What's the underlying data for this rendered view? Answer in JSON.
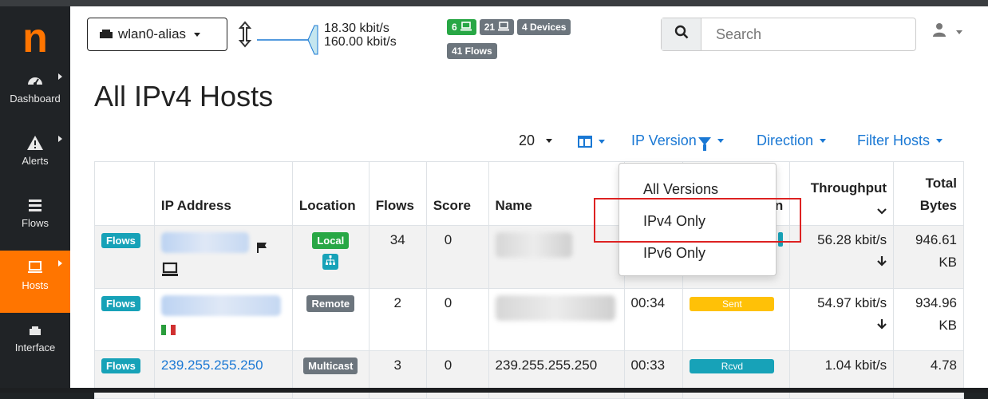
{
  "app": {
    "logo_letter": "n",
    "interface": "wlan0-alias",
    "throughput": {
      "upload": "18.30 kbit/s",
      "download": "160.00 kbit/s"
    },
    "badges": {
      "hosts_local": "6",
      "hosts_remote": "21",
      "devices": "4 Devices",
      "flows": "41 Flows"
    },
    "search_placeholder": "Search"
  },
  "sidebar": {
    "items": [
      {
        "label": "Dashboard"
      },
      {
        "label": "Alerts"
      },
      {
        "label": "Flows"
      },
      {
        "label": "Hosts"
      },
      {
        "label": "Interface"
      }
    ]
  },
  "page": {
    "title": "All IPv4 Hosts"
  },
  "toolbar": {
    "page_size": "20",
    "ip_version": "IP Version",
    "direction": "Direction",
    "filter_hosts": "Filter Hosts"
  },
  "dropdown": {
    "items": [
      "All Versions",
      "IPv4 Only",
      "IPv6 Only"
    ]
  },
  "table": {
    "headers": [
      "",
      "IP Address",
      "Location",
      "Flows",
      "Score",
      "Name",
      "",
      "n",
      "Throughput",
      "Total Bytes"
    ],
    "header_throughput": "Throughput",
    "header_total": "Total",
    "header_bytes": "Bytes",
    "rows": [
      {
        "flows_btn": "Flows",
        "ip": "",
        "location": "Local",
        "flows": "34",
        "score": "0",
        "name": "",
        "seen": "",
        "bar": "",
        "throughput": "56.28 kbit/s",
        "bytes1": "946.61",
        "bytes2": "KB"
      },
      {
        "flows_btn": "Flows",
        "ip": "",
        "location": "Remote",
        "flows": "2",
        "score": "0",
        "name": "",
        "seen": "00:34",
        "bar": "Sent",
        "throughput": "54.97 kbit/s",
        "bytes1": "934.96",
        "bytes2": "KB"
      },
      {
        "flows_btn": "Flows",
        "ip": "239.255.255.250",
        "location": "Multicast",
        "flows": "3",
        "score": "0",
        "name": "239.255.255.250",
        "seen": "00:33",
        "bar": "Rcvd",
        "throughput": "1.04 kbit/s",
        "bytes1": "4.78",
        "bytes2": ""
      }
    ]
  },
  "colors": {
    "accent": "#ff7500",
    "link": "#1a78d4",
    "info": "#17a2b8"
  }
}
